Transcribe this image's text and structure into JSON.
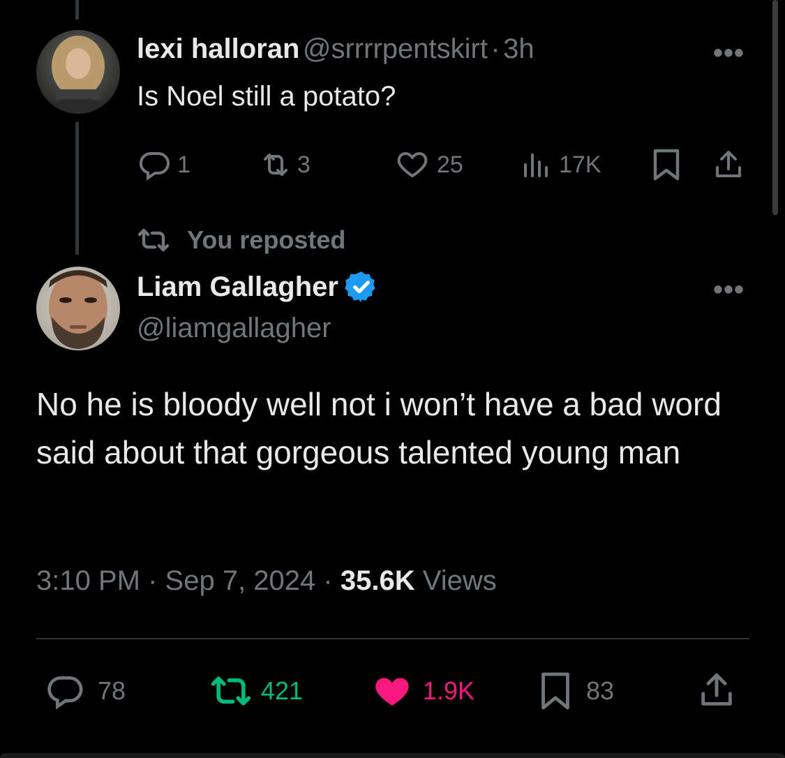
{
  "reply_tweet": {
    "author_name": "lexi halloran",
    "author_handle": "@srrrrpentskirt",
    "separator": "·",
    "time": "3h",
    "text": "Is Noel still a potato?",
    "more": "•••",
    "replies": "1",
    "reposts": "3",
    "likes": "25",
    "views": "17K"
  },
  "repost_indicator": {
    "label": "You reposted"
  },
  "main_tweet": {
    "author_name": "Liam Gallagher",
    "author_handle": "@liamgallagher",
    "verified": true,
    "more": "•••",
    "text": "No he is bloody well not i won’t have a bad word said about that gorgeous talented young man",
    "time": "3:10 PM",
    "sep1": "·",
    "date": "Sep 7, 2024",
    "sep2": "·",
    "view_count": "35.6K",
    "views_label": "Views",
    "replies": "78",
    "reposts": "421",
    "likes": "1.9K",
    "bookmarks": "83"
  },
  "colors": {
    "background": "#000000",
    "text": "#e7e9ea",
    "muted": "#71767b",
    "verified": "#1d9bf0",
    "repost_active": "#00ba7c",
    "like_active": "#f91880"
  },
  "icons": {
    "reply": "reply-icon",
    "repost": "repost-icon",
    "like": "heart-icon",
    "views": "views-icon",
    "bookmark": "bookmark-icon",
    "share": "share-icon",
    "verified": "verified-badge-icon"
  }
}
